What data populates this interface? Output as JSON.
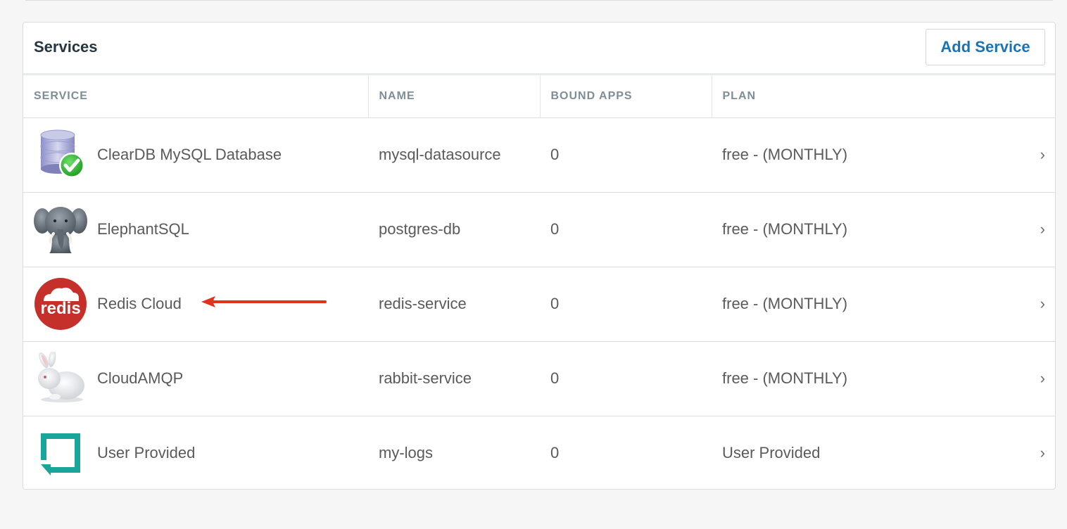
{
  "panel": {
    "title": "Services",
    "add_button": "Add Service"
  },
  "table": {
    "columns": [
      "SERVICE",
      "NAME",
      "BOUND APPS",
      "PLAN"
    ],
    "rows": [
      {
        "service": "ClearDB MySQL Database",
        "icon": "database-check-icon",
        "name": "mysql-datasource",
        "bound_apps": "0",
        "plan": "free - (MONTHLY)"
      },
      {
        "service": "ElephantSQL",
        "icon": "elephant-icon",
        "name": "postgres-db",
        "bound_apps": "0",
        "plan": "free - (MONTHLY)"
      },
      {
        "service": "Redis Cloud",
        "icon": "redis-logo-icon",
        "name": "redis-service",
        "bound_apps": "0",
        "plan": "free - (MONTHLY)"
      },
      {
        "service": "CloudAMQP",
        "icon": "rabbit-icon",
        "name": "rabbit-service",
        "bound_apps": "0",
        "plan": "free - (MONTHLY)"
      },
      {
        "service": "User Provided",
        "icon": "user-provided-icon",
        "name": "my-logs",
        "bound_apps": "0",
        "plan": "User Provided"
      }
    ]
  },
  "annotation": {
    "arrow_color": "#e0321c",
    "points_to": "Redis Cloud"
  },
  "colors": {
    "accent": "#1a73b5",
    "redis_red": "#c6302b",
    "user_provided_teal": "#1aa59b"
  }
}
